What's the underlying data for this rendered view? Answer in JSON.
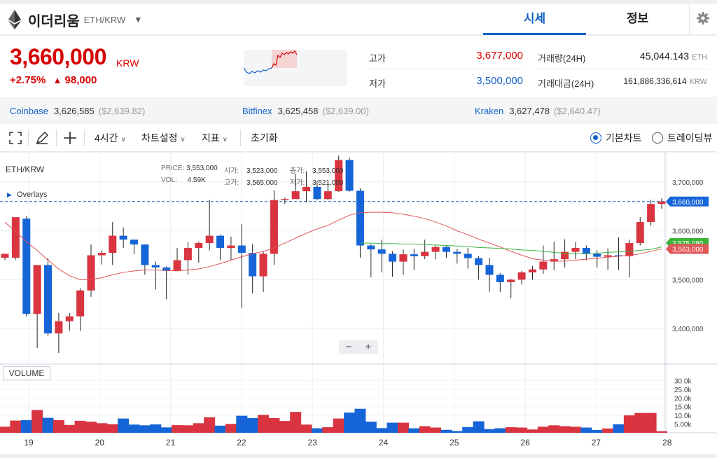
{
  "header": {
    "coin_name": "이더리움",
    "pair": "ETH/KRW",
    "tabs": [
      {
        "label": "시세",
        "active": true
      },
      {
        "label": "정보",
        "active": false
      }
    ],
    "settings_icon": "gear-icon"
  },
  "summary": {
    "price": "3,660,000",
    "unit": "KRW",
    "change_rate": "+2.75%",
    "change_arrow": "▲",
    "change_amount": "98,000",
    "high_label": "고가",
    "high_value": "3,677,000",
    "low_label": "저가",
    "low_value": "3,500,000",
    "volume_label": "거래량(24H)",
    "volume_value": "45,044.143",
    "volume_unit": "ETH",
    "amount_label": "거래대금(24H)",
    "amount_value": "161,886,336,614",
    "amount_unit": "KRW"
  },
  "exchanges": [
    {
      "name": "Coinbase",
      "value": "3,626,585",
      "usd": "($2,639.82)"
    },
    {
      "name": "Bitfinex",
      "value": "3,625,458",
      "usd": "($2,639.00)"
    },
    {
      "name": "Kraken",
      "value": "3,627,478",
      "usd": "($2,640.47)"
    }
  ],
  "toolbar": {
    "interval": "4시간",
    "chart_settings": "차트설정",
    "indicators": "지표",
    "reset": "초기화",
    "radio_basic": "기본차트",
    "radio_tradingview": "트레이딩뷰"
  },
  "chart": {
    "symbol": "ETH/KRW",
    "overlays": "Overlays",
    "info": {
      "price_k": "PRICE:",
      "price_v": "3,553,000",
      "open_k": "시가:",
      "open_v": "3,523,000",
      "close_k": "종가:",
      "close_v": "3,553,000",
      "vol_k": "VOL:",
      "vol_v": "4.59K",
      "high_k": "고가:",
      "high_v": "3,565,000",
      "low_k": "저가:",
      "low_v": "3,521,000"
    },
    "volume_label": "VOLUME",
    "zoom_out": "−",
    "zoom_in": "+",
    "price_tag_current": "3,660,000",
    "price_tag_ma_green": "3,575,080",
    "price_tag_ma_red": "3,563,000",
    "up_color": "#d9343f",
    "down_color": "#1565d8"
  },
  "chart_data": {
    "type": "candlestick",
    "y_ticks": [
      "3,400,000",
      "3,500,000",
      "3,600,000",
      "3,700,000"
    ],
    "ylim": [
      3330000,
      3760000
    ],
    "x_ticks": [
      "19",
      "20",
      "21",
      "22",
      "23",
      "24",
      "25",
      "26",
      "27",
      "28"
    ],
    "volume_ticks": [
      "5.00k",
      "10.0k",
      "15.0k",
      "20.0k",
      "25.0k",
      "30.0k"
    ],
    "volume_max": 33000,
    "candles": [
      [
        3545000,
        3553000,
        3540000,
        3545000,
        3500
      ],
      [
        3545000,
        3628000,
        3541000,
        3625000,
        7000
      ],
      [
        3625000,
        3430000,
        3425000,
        3630000,
        7300
      ],
      [
        3430000,
        3530000,
        3360000,
        3430000,
        13100
      ],
      [
        3530000,
        3390000,
        3385000,
        3545000,
        8600
      ],
      [
        3390000,
        3415000,
        3350000,
        3432000,
        7300
      ],
      [
        3415000,
        3425000,
        3395000,
        3432000,
        4500
      ],
      [
        3425000,
        3478000,
        3395000,
        3482000,
        6900
      ],
      [
        3478000,
        3550000,
        3465000,
        3572000,
        6400
      ],
      [
        3550000,
        3555000,
        3531000,
        3560000,
        5500
      ],
      [
        3555000,
        3590000,
        3530000,
        3618000,
        4900
      ],
      [
        3590000,
        3582000,
        3565000,
        3607000,
        8200
      ],
      [
        3582000,
        3572000,
        3552000,
        3577000,
        4700
      ],
      [
        3572000,
        3530000,
        3510000,
        3572000,
        4300
      ],
      [
        3530000,
        3525000,
        3480000,
        3537000,
        4800
      ],
      [
        3525000,
        3518000,
        3460000,
        3527000,
        3100
      ],
      [
        3518000,
        3540000,
        3520000,
        3565000,
        4400
      ],
      [
        3540000,
        3565000,
        3510000,
        3577000,
        4300
      ],
      [
        3565000,
        3575000,
        3535000,
        3578000,
        5500
      ],
      [
        3575000,
        3590000,
        3560000,
        3663000,
        8900
      ],
      [
        3590000,
        3565000,
        3540000,
        3592000,
        4100
      ],
      [
        3565000,
        3570000,
        3540000,
        3588000,
        5100
      ],
      [
        3570000,
        3555000,
        3442000,
        3614000,
        9800
      ],
      [
        3555000,
        3507000,
        3472000,
        3573000,
        8500
      ],
      [
        3507000,
        3553000,
        3475000,
        3557000,
        10300
      ],
      [
        3553000,
        3663000,
        3530000,
        3683000,
        8500
      ],
      [
        3663000,
        3665000,
        3655000,
        3668000,
        6800
      ],
      [
        3665000,
        3681000,
        3668000,
        3717000,
        12000
      ],
      [
        3681000,
        3690000,
        3658000,
        3722000,
        4700
      ],
      [
        3690000,
        3665000,
        3663000,
        3703000,
        2600
      ],
      [
        3665000,
        3681000,
        3663000,
        3700000,
        3200
      ],
      [
        3681000,
        3745000,
        3680000,
        3754000,
        8200
      ],
      [
        3745000,
        3682000,
        3680000,
        3750000,
        11600
      ],
      [
        3682000,
        3570000,
        3545000,
        3687000,
        13800
      ],
      [
        3570000,
        3562000,
        3505000,
        3573000,
        6400
      ],
      [
        3562000,
        3553000,
        3515000,
        3582000,
        2700
      ],
      [
        3553000,
        3537000,
        3506000,
        3558000,
        5800
      ],
      [
        3537000,
        3552000,
        3510000,
        3562000,
        5800
      ],
      [
        3552000,
        3548000,
        3520000,
        3563000,
        2600
      ],
      [
        3548000,
        3557000,
        3542000,
        3582000,
        3800
      ],
      [
        3557000,
        3567000,
        3542000,
        3570000,
        3000
      ],
      [
        3567000,
        3557000,
        3545000,
        3569000,
        1700
      ],
      [
        3557000,
        3553000,
        3533000,
        3563000,
        1000
      ],
      [
        3553000,
        3544000,
        3523000,
        3565000,
        3300
      ],
      [
        3544000,
        3530000,
        3500000,
        3548000,
        6600
      ],
      [
        3530000,
        3510000,
        3475000,
        3545000,
        2100
      ],
      [
        3510000,
        3495000,
        3475000,
        3513000,
        2600
      ],
      [
        3495000,
        3500000,
        3462000,
        3502000,
        3200
      ],
      [
        3500000,
        3515000,
        3490000,
        3518000,
        3000
      ],
      [
        3515000,
        3521000,
        3500000,
        3528000,
        1900
      ],
      [
        3521000,
        3537000,
        3512000,
        3570000,
        3500
      ],
      [
        3537000,
        3542000,
        3520000,
        3578000,
        4300
      ],
      [
        3542000,
        3557000,
        3525000,
        3583000,
        3800
      ],
      [
        3557000,
        3565000,
        3542000,
        3577000,
        3500
      ],
      [
        3565000,
        3553000,
        3540000,
        3570000,
        3000
      ],
      [
        3553000,
        3547000,
        3525000,
        3560000,
        1600
      ],
      [
        3547000,
        3550000,
        3520000,
        3564000,
        2500
      ],
      [
        3550000,
        3548000,
        3520000,
        3587000,
        4900
      ],
      [
        3548000,
        3575000,
        3505000,
        3582000,
        10000
      ],
      [
        3575000,
        3618000,
        3570000,
        3628000,
        11400
      ],
      [
        3618000,
        3655000,
        3610000,
        3664000,
        11400
      ],
      [
        3655000,
        3660000,
        3645000,
        3667000,
        900
      ]
    ],
    "ma_red": [
      3618000,
      3598000,
      3578000,
      3560000,
      3540000,
      3522000,
      3508000,
      3500000,
      3500000,
      3504000,
      3510000,
      3515000,
      3518000,
      3520000,
      3520000,
      3519000,
      3518000,
      3520000,
      3522000,
      3527000,
      3533000,
      3540000,
      3547000,
      3553000,
      3558000,
      3565000,
      3575000,
      3585000,
      3595000,
      3604000,
      3611000,
      3622000,
      3632000,
      3637000,
      3638000,
      3638000,
      3637000,
      3634000,
      3630000,
      3625000,
      3618000,
      3610000,
      3600000,
      3592000,
      3583000,
      3575000,
      3567000,
      3558000,
      3550000,
      3543000,
      3540000,
      3538000,
      3538000,
      3540000,
      3542000,
      3544000,
      3546000,
      3548000,
      3550000,
      3553000,
      3558000,
      3563000
    ],
    "ma_green_start": 33,
    "ma_green": [
      3575000,
      3575000,
      3574000,
      3574000,
      3573000,
      3573000,
      3572000,
      3571000,
      3570000,
      3569000,
      3568000,
      3566000,
      3565000,
      3564000,
      3563000,
      3561000,
      3560000,
      3558000,
      3556000,
      3554000,
      3553000,
      3553000,
      3554000,
      3556000,
      3557000,
      3558000,
      3560000,
      3562000,
      3567000
    ]
  }
}
